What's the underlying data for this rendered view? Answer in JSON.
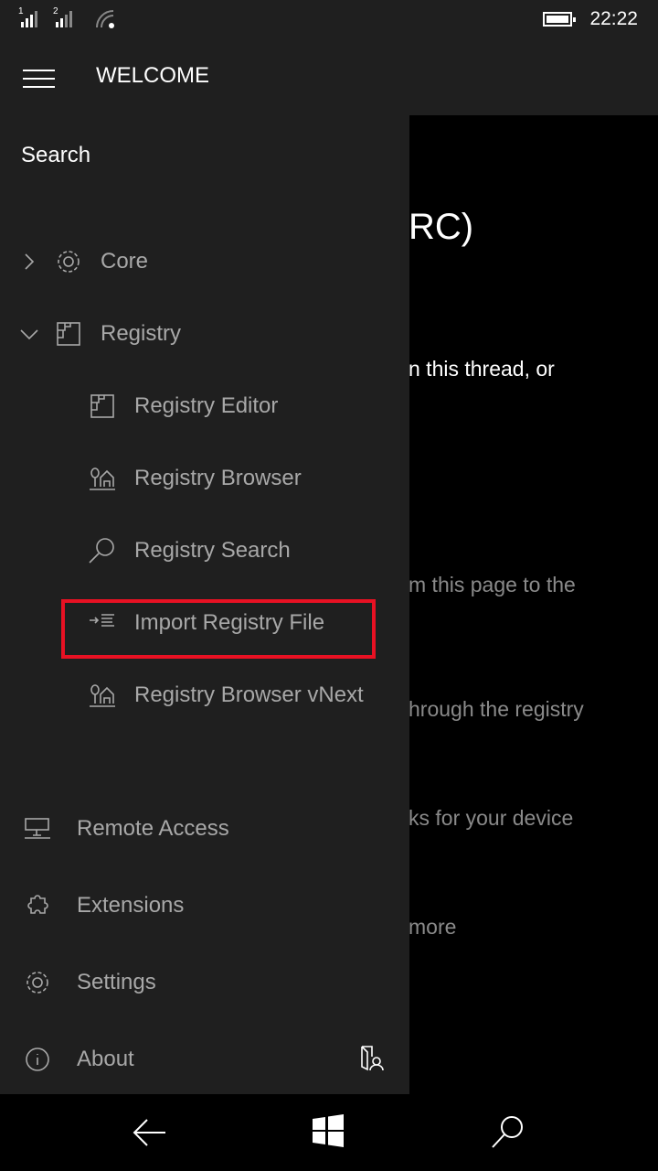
{
  "status_bar": {
    "time": "22:22",
    "sim1": "1",
    "sim2": "2",
    "icons": [
      "signal-icon",
      "signal-icon",
      "wifi-icon",
      "battery-icon"
    ]
  },
  "header": {
    "title": "WELCOME"
  },
  "main": {
    "fragments": [
      "RC)",
      "n this thread, or",
      "m this page to the",
      "hrough the registry",
      "ks for your device",
      "more"
    ]
  },
  "pane": {
    "search": "Search",
    "core": "Core",
    "registry": "Registry",
    "registry_items": [
      "Registry Editor",
      "Registry Browser",
      "Registry Search",
      "Import Registry File",
      "Registry Browser vNext"
    ],
    "bottom_items": [
      "Remote Access",
      "Extensions",
      "Settings",
      "About"
    ]
  },
  "highlight_color": "#e81123"
}
